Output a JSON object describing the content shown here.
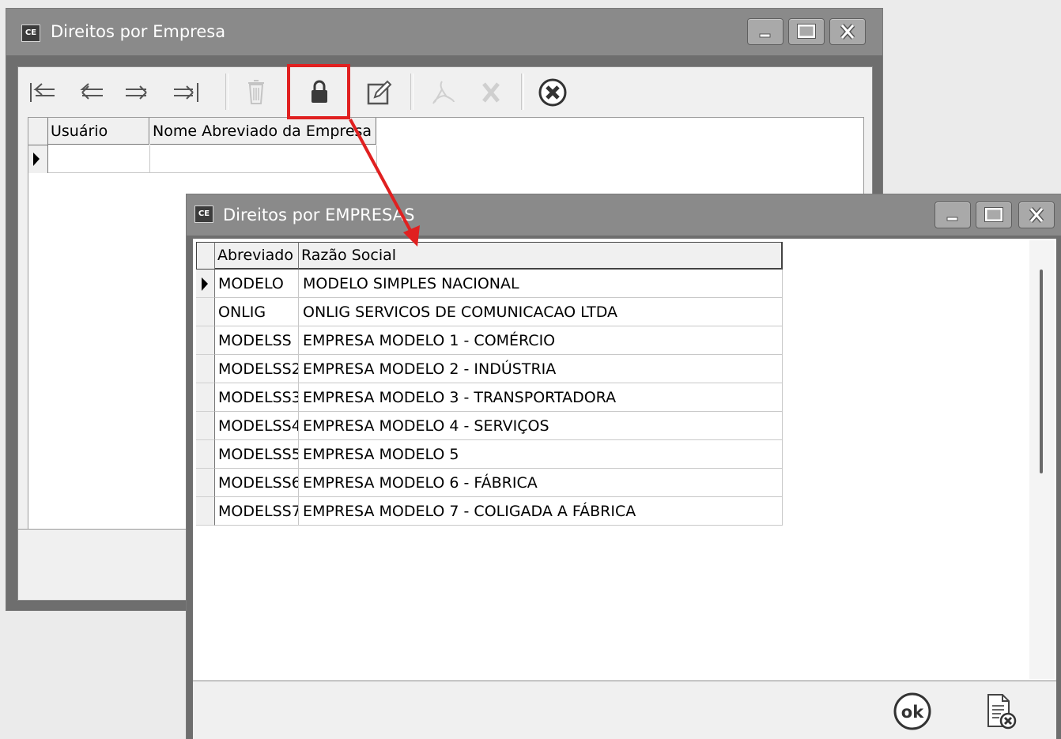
{
  "back_window": {
    "icon": "CE",
    "title": "Direitos por Empresa",
    "toolbar": {
      "buttons": [
        "first-record-icon",
        "previous-record-icon",
        "next-record-icon",
        "last-record-icon",
        "delete-icon",
        "lock-icon",
        "edit-icon",
        "pdf-icon",
        "cancel-icon",
        "close-circle-icon"
      ]
    },
    "grid": {
      "columns": [
        "Usuário",
        "Nome Abreviado da Empresa"
      ]
    }
  },
  "front_window": {
    "icon": "CE",
    "title": "Direitos por EMPRESAS",
    "grid": {
      "columns": [
        "Abreviado",
        "Razão Social"
      ],
      "rows": [
        {
          "abreviado": "MODELO",
          "razao": "MODELO SIMPLES NACIONAL"
        },
        {
          "abreviado": "ONLIG",
          "razao": "ONLIG SERVICOS DE COMUNICACAO LTDA"
        },
        {
          "abreviado": "MODELSS",
          "razao": "EMPRESA MODELO 1 - COMÉRCIO"
        },
        {
          "abreviado": "MODELSS2",
          "razao": "EMPRESA MODELO 2 - INDÚSTRIA"
        },
        {
          "abreviado": "MODELSS3",
          "razao": "EMPRESA MODELO 3 - TRANSPORTADORA"
        },
        {
          "abreviado": "MODELSS4",
          "razao": "EMPRESA MODELO 4 - SERVIÇOS"
        },
        {
          "abreviado": "MODELSS5",
          "razao": "EMPRESA MODELO 5"
        },
        {
          "abreviado": "MODELSS6",
          "razao": "EMPRESA MODELO 6 - FÁBRICA"
        },
        {
          "abreviado": "MODELSS7",
          "razao": "EMPRESA MODELO 7 - COLIGADA A FÁBRICA"
        }
      ]
    },
    "footer": {
      "ok_label": "ok",
      "cancel_icon": "report-cancel-icon"
    }
  },
  "annotation": {
    "highlight_color": "#e02020"
  }
}
